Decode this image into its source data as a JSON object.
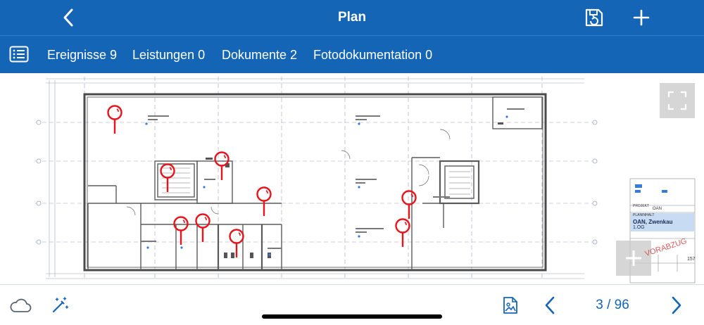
{
  "header": {
    "title": "Plan",
    "back_icon": "chevron-left-icon",
    "save_icon": "save-sync-icon",
    "add_icon": "plus-icon"
  },
  "tabs": [
    {
      "label": "Ereignisse 9"
    },
    {
      "label": "Leistungen 0"
    },
    {
      "label": "Dokumente 2"
    },
    {
      "label": "Fotodokumentation 0"
    }
  ],
  "list_icon": "list-icon",
  "title_block": {
    "project_label": "PROJEKT",
    "project_value": "OAN",
    "plan_label": "PLANINHALT",
    "plan_name": "OAN, Zwenkau",
    "floor": "1.OG",
    "stamp": "VORABZUG",
    "plan_no": "157"
  },
  "controls": {
    "fullscreen_icon": "fullscreen-icon",
    "zoom_icon": "zoom-plus-icon"
  },
  "markers_count": 9,
  "footer": {
    "cloud_icon": "cloud-icon",
    "wand_icon": "magic-wand-icon",
    "image_icon": "image-document-icon",
    "prev_icon": "chevron-left-icon",
    "next_icon": "chevron-right-icon",
    "page_indicator": "3 / 96"
  },
  "colors": {
    "brand": "#1565b6",
    "marker": "#e8141c",
    "drawing": "#555555"
  }
}
